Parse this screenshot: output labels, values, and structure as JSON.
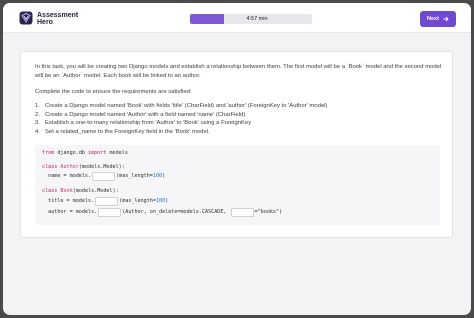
{
  "brand": {
    "line1": "Assessment",
    "line2": "Hero"
  },
  "progress": {
    "fraction": 0.28,
    "timer": "4:57 min"
  },
  "next_button": {
    "label": "Next"
  },
  "task": {
    "intro": "In this task, you will be creating two Django models and establish a relationship between them. The first model will be a `Book` model and the second model will be an `Author` model. Each book will be linked to an author.",
    "lead": "Complete the code to ensure the requirements are satisfied:",
    "steps": [
      {
        "num": "1.",
        "text": "Create a Django model named 'Book' with fields 'title' (CharField) and 'author' (ForeignKey to 'Author' model)"
      },
      {
        "num": "2.",
        "text": "Create a Django model named 'Author' with a field named 'name' (CharField)"
      },
      {
        "num": "3.",
        "text": "Establish a one-to-many relationship from 'Author' to 'Book' using a ForeignKey"
      },
      {
        "num": "4.",
        "text": "Set a related_name to the ForeignKey field in the 'Book' model."
      }
    ]
  },
  "code": {
    "l1_from": "from",
    "l1_mod": " django.db ",
    "l1_import": "import",
    "l1_rest": " models",
    "l2_class": "class",
    "l2_name": " Author",
    "l2_rest": "(models.Model):",
    "l3_pre": "  name = models.",
    "l3_mid": "(max_length=",
    "l3_num": "100",
    "l3_end": ")",
    "l4_class": "class",
    "l4_name": " Book",
    "l4_rest": "(models.Model):",
    "l5_pre": "  title = models.",
    "l5_mid": "(max_length=",
    "l5_num": "100",
    "l5_end": ")",
    "l6_pre": "  author = models.",
    "l6_mid": "(Author, on_delete=models.CASCADE, ",
    "l6_end": "=\"books\")",
    "blank_value": ""
  },
  "colors": {
    "accent": "#7049d3",
    "progress_fill": "#7e59d6",
    "keyword": "#c2185b",
    "number": "#1a73c9"
  },
  "icons": {
    "logo": "assessment-hero-logo-icon",
    "next": "arrow-right-icon"
  }
}
